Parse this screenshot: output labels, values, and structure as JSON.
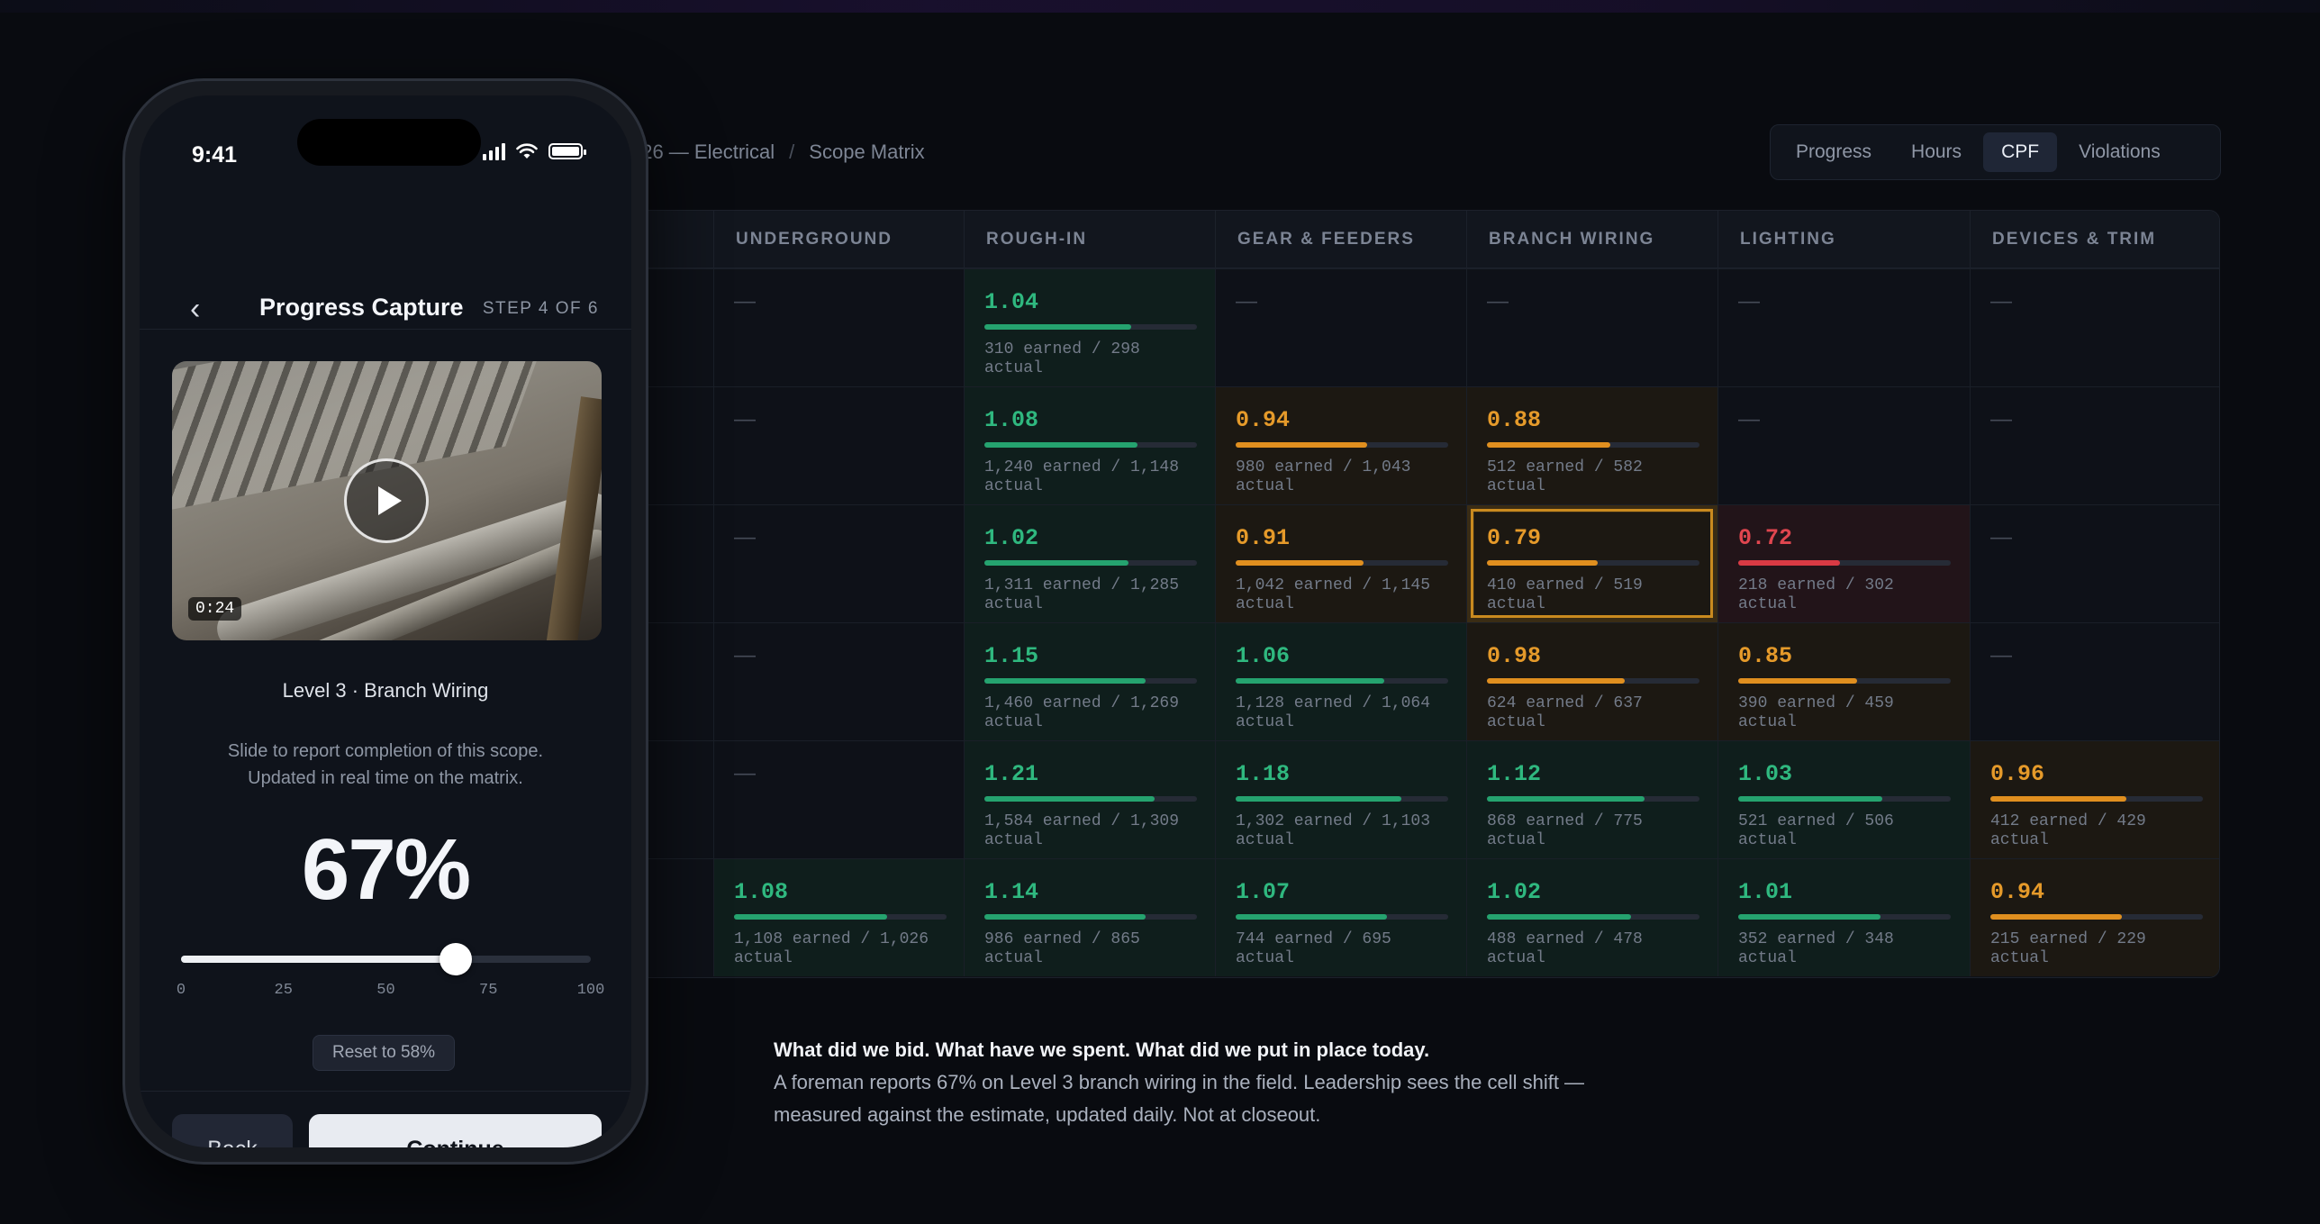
{
  "breadcrumb": {
    "current_project": "/ 26 — Electrical",
    "separator": "/",
    "page": "Scope Matrix"
  },
  "tabs": [
    {
      "label": "Progress",
      "active": false
    },
    {
      "label": "Hours",
      "active": false
    },
    {
      "label": "CPF",
      "active": true
    },
    {
      "label": "Violations",
      "active": false
    }
  ],
  "matrix": {
    "columns": [
      "UNDERGROUND",
      "ROUGH-IN",
      "GEAR & FEEDERS",
      "BRANCH WIRING",
      "LIGHTING",
      "DEVICES & TRIM"
    ],
    "rows": [
      [
        {
          "empty": true,
          "label": "—"
        },
        {
          "value": "1.04",
          "status": "green",
          "progress": 0.69,
          "detail": "310 earned / 298 actual"
        },
        {
          "empty": true,
          "label": "—"
        },
        {
          "empty": true,
          "label": "—"
        },
        {
          "empty": true,
          "label": "—"
        },
        {
          "empty": true,
          "label": "—"
        }
      ],
      [
        {
          "empty": true,
          "label": "—"
        },
        {
          "value": "1.08",
          "status": "green",
          "progress": 0.72,
          "detail": "1,240 earned / 1,148 actual"
        },
        {
          "value": "0.94",
          "status": "amber",
          "progress": 0.62,
          "detail": "980 earned / 1,043 actual"
        },
        {
          "value": "0.88",
          "status": "amber",
          "progress": 0.58,
          "detail": "512 earned / 582 actual"
        },
        {
          "empty": true,
          "label": "—"
        },
        {
          "empty": true,
          "label": "—"
        }
      ],
      [
        {
          "empty": true,
          "label": "—"
        },
        {
          "value": "1.02",
          "status": "green",
          "progress": 0.68,
          "detail": "1,311 earned / 1,285 actual"
        },
        {
          "value": "0.91",
          "status": "amber",
          "progress": 0.6,
          "detail": "1,042 earned / 1,145 actual"
        },
        {
          "value": "0.79",
          "status": "amber",
          "progress": 0.52,
          "detail": "410 earned / 519 actual",
          "selected": true
        },
        {
          "value": "0.72",
          "status": "red",
          "progress": 0.48,
          "detail": "218 earned / 302 actual"
        },
        {
          "empty": true,
          "label": "—"
        }
      ],
      [
        {
          "empty": true,
          "label": "—"
        },
        {
          "value": "1.15",
          "status": "green",
          "progress": 0.76,
          "detail": "1,460 earned / 1,269 actual"
        },
        {
          "value": "1.06",
          "status": "green",
          "progress": 0.7,
          "detail": "1,128 earned / 1,064 actual"
        },
        {
          "value": "0.98",
          "status": "amber",
          "progress": 0.65,
          "detail": "624 earned / 637 actual"
        },
        {
          "value": "0.85",
          "status": "amber",
          "progress": 0.56,
          "detail": "390 earned / 459 actual"
        },
        {
          "empty": true,
          "label": "—"
        }
      ],
      [
        {
          "empty": true,
          "label": "—"
        },
        {
          "value": "1.21",
          "status": "green",
          "progress": 0.8,
          "detail": "1,584 earned / 1,309 actual"
        },
        {
          "value": "1.18",
          "status": "green",
          "progress": 0.78,
          "detail": "1,302 earned / 1,103 actual"
        },
        {
          "value": "1.12",
          "status": "green",
          "progress": 0.74,
          "detail": "868 earned / 775 actual"
        },
        {
          "value": "1.03",
          "status": "green",
          "progress": 0.68,
          "detail": "521 earned / 506 actual"
        },
        {
          "value": "0.96",
          "status": "amber",
          "progress": 0.64,
          "detail": "412 earned / 429 actual"
        }
      ],
      [
        {
          "value": "1.08",
          "status": "green",
          "progress": 0.72,
          "detail": "1,108 earned / 1,026 actual"
        },
        {
          "value": "1.14",
          "status": "green",
          "progress": 0.76,
          "detail": "986 earned / 865 actual"
        },
        {
          "value": "1.07",
          "status": "green",
          "progress": 0.71,
          "detail": "744 earned / 695 actual"
        },
        {
          "value": "1.02",
          "status": "green",
          "progress": 0.68,
          "detail": "488 earned / 478 actual"
        },
        {
          "value": "1.01",
          "status": "green",
          "progress": 0.67,
          "detail": "352 earned / 348 actual"
        },
        {
          "value": "0.94",
          "status": "amber",
          "progress": 0.62,
          "detail": "215 earned / 229 actual"
        }
      ]
    ]
  },
  "caption": {
    "headline": "What did we bid. What have we spent. What did we put in place today.",
    "body": "A foreman reports 67% on Level 3 branch wiring in the field. Leadership sees the cell shift — measured against the estimate, updated daily. Not at closeout."
  },
  "phone": {
    "status_time": "9:41",
    "nav_back_icon": "chevron-left-icon",
    "title": "Progress Capture",
    "step": "STEP 4 OF 6",
    "video_duration": "0:24",
    "scope_label": "Level 3 · Branch Wiring",
    "helper_line1": "Slide to report completion of this scope.",
    "helper_line2": "Updated in real time on the matrix.",
    "percent_label": "67%",
    "percent_value": 67,
    "slider_ticks": [
      "0",
      "25",
      "50",
      "75",
      "100"
    ],
    "reset_label": "Reset to 58%",
    "back_label": "Back",
    "continue_label": "Continue"
  },
  "colors": {
    "green": "#2fb87f",
    "amber": "#e59a2a",
    "red": "#e0464f",
    "background": "#090b10"
  }
}
